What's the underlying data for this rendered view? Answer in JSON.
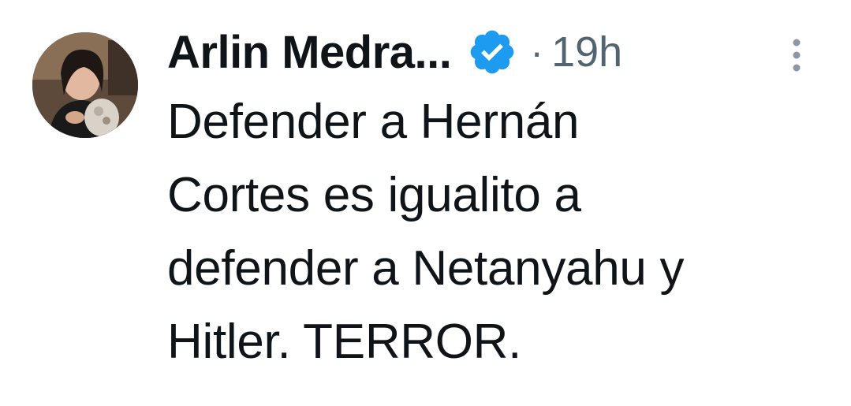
{
  "author": {
    "display_name": "Arlin Medra...",
    "verified": true,
    "avatar_icon": "user-avatar-photo"
  },
  "meta": {
    "separator": "·",
    "timestamp": "19h"
  },
  "tweet": {
    "text_lines": [
      "Defender a Hernán",
      "Cortes es igualito a",
      "defender a Netanyahu y",
      "Hitler. TERROR."
    ]
  },
  "colors": {
    "text_primary": "#0f1419",
    "text_secondary": "#536471",
    "verified_blue": "#1d9bf0"
  },
  "icons": {
    "verified": "verified-badge-icon",
    "more": "more-options-icon"
  }
}
